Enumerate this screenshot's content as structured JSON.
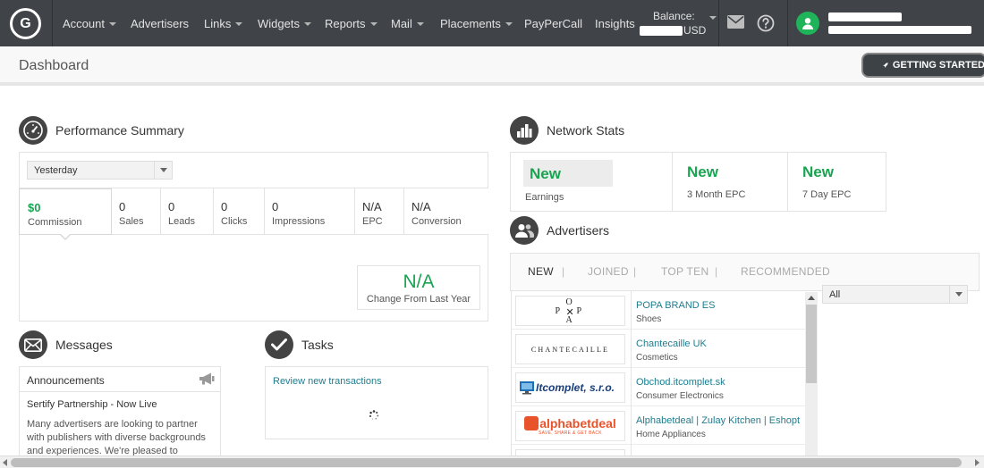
{
  "nav": {
    "logo_text": "G",
    "items": [
      {
        "label": "Account",
        "dropdown": true
      },
      {
        "label": "Advertisers",
        "dropdown": false
      },
      {
        "label": "Links",
        "dropdown": true
      },
      {
        "label": "Widgets",
        "dropdown": true
      },
      {
        "label": "Reports",
        "dropdown": true
      },
      {
        "label": "Mail",
        "dropdown": true
      },
      {
        "label": "Placements",
        "dropdown": true
      },
      {
        "label": "PayPerCall",
        "dropdown": false
      },
      {
        "label": "Insights",
        "dropdown": false
      }
    ],
    "balance_label": "Balance:",
    "balance_currency": "USD",
    "icons": [
      "mail-icon",
      "help-icon",
      "user-icon"
    ]
  },
  "header": {
    "title": "Dashboard",
    "getting_started": "GETTING STARTED"
  },
  "performance": {
    "title": "Performance Summary",
    "period": "Yesterday",
    "metrics": [
      {
        "value": "$0",
        "label": "Commission"
      },
      {
        "value": "0",
        "label": "Sales"
      },
      {
        "value": "0",
        "label": "Leads"
      },
      {
        "value": "0",
        "label": "Clicks"
      },
      {
        "value": "0",
        "label": "Impressions"
      },
      {
        "value": "N/A",
        "label": "EPC"
      },
      {
        "value": "N/A",
        "label": "Conversion"
      }
    ],
    "change_value": "N/A",
    "change_label": "Change From Last Year"
  },
  "messages": {
    "title": "Messages",
    "announcements_label": "Announcements",
    "headline": "Sertify Partnership - Now Live",
    "body_lines": [
      "Many advertisers are looking to partner",
      "with publishers with diverse backgrounds",
      "and experiences. We're pleased to"
    ]
  },
  "tasks": {
    "title": "Tasks",
    "items": [
      "Review new transactions"
    ]
  },
  "network_stats": {
    "title": "Network Stats",
    "cells": [
      {
        "value": "New",
        "label": "Earnings"
      },
      {
        "value": "New",
        "label": "3 Month EPC"
      },
      {
        "value": "New",
        "label": "7 Day EPC"
      }
    ]
  },
  "advertisers": {
    "title": "Advertisers",
    "tabs": [
      "NEW",
      "JOINED",
      "TOP TEN",
      "RECOMMENDED"
    ],
    "filter": "All",
    "rows": [
      {
        "name": "POPA BRAND ES",
        "category": "Shoes",
        "logo": "POPA"
      },
      {
        "name": "Chantecaille UK",
        "category": "Cosmetics",
        "logo": "CHANTECAILLE"
      },
      {
        "name": "Obchod.itcomplet.sk",
        "category": "Consumer Electronics",
        "logo": "Itcomplet, s.r.o."
      },
      {
        "name": "Alphabetdeal | Zulay Kitchen | Eshopt",
        "category": "Home Appliances",
        "logo": "alphabetdeal",
        "logo_tagline": "SAVE, SHARE & GET BACK"
      }
    ]
  },
  "colors": {
    "nav_bg": "#404448",
    "accent_green": "#19a451",
    "link_teal": "#1e7d8f"
  }
}
